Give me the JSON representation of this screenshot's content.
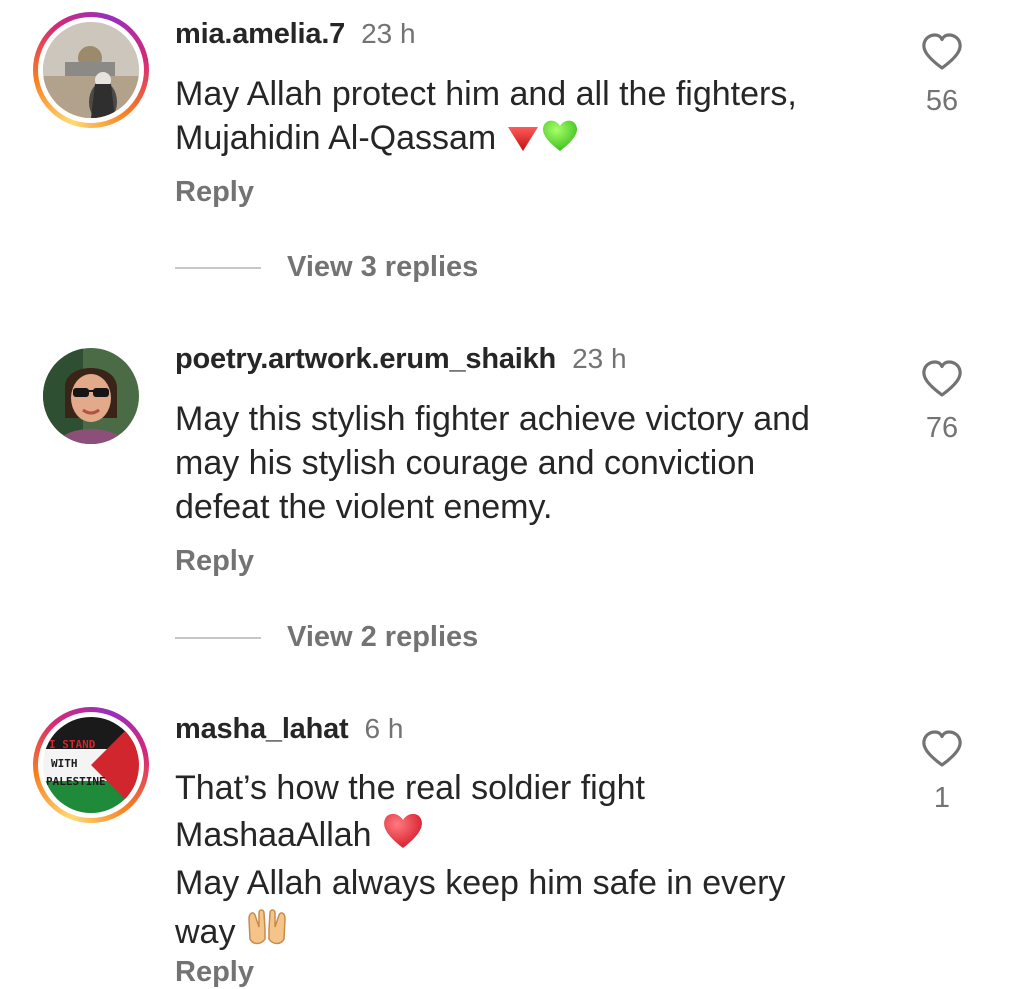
{
  "comments": [
    {
      "username": "mia.amelia.7",
      "time": "23 h",
      "text": "May Allah protect him and all the fighters,\nMujahidin Al-Qassam",
      "emoji": [
        "red-triangle-down",
        "green-heart"
      ],
      "reply_label": "Reply",
      "view_replies": "View 3 replies",
      "likes": "56",
      "avatar": "al-aqsa-photo"
    },
    {
      "username": "poetry.artwork.erum_shaikh",
      "time": "23 h",
      "text": "May this stylish fighter achieve victory and\nmay his stylish courage and conviction\ndefeat the violent enemy.",
      "reply_label": "Reply",
      "view_replies": "View 2 replies",
      "likes": "76",
      "avatar": "woman-sunglasses-photo"
    },
    {
      "username": "masha_lahat",
      "time": "6 h",
      "text_line1": "That’s how the real soldier fight",
      "text_line2": "MashaaAllah",
      "text_line3": "May Allah always keep him safe in every",
      "text_line4": "way",
      "emoji": [
        "red-heart",
        "palms-up-together"
      ],
      "reply_label": "Reply",
      "likes": "1",
      "avatar": "palestine-flag",
      "avatar_text": [
        "I STAND",
        "WITH",
        "PALESTINE"
      ]
    }
  ],
  "colors": {
    "text": "#262626",
    "muted": "#737373",
    "divider": "#c7c7c7",
    "story_ring": [
      "#feda75",
      "#fa7e1e",
      "#d62976",
      "#962fbf"
    ]
  }
}
